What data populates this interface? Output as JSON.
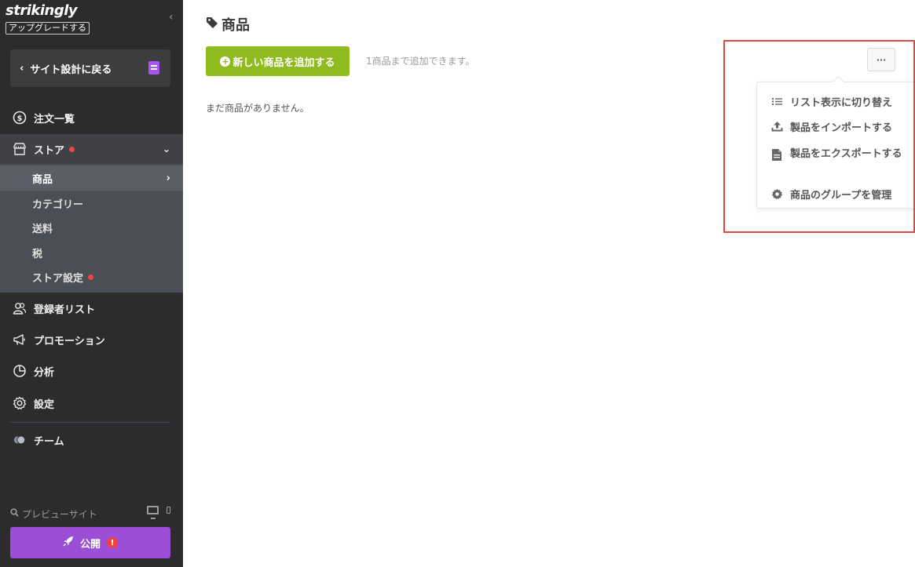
{
  "sidebar": {
    "logo": "strikingly",
    "upgrade_label": "アップグレードする",
    "back_label": "サイト設計に戻る",
    "nav": {
      "orders": "注文一覧",
      "store": "ストア",
      "subscribers": "登録者リスト",
      "promotion": "プロモーション",
      "analytics": "分析",
      "settings": "設定",
      "team": "チーム"
    },
    "store_items": {
      "products": "商品",
      "categories": "カテゴリー",
      "shipping": "送料",
      "tax": "税",
      "store_settings": "ストア設定"
    },
    "preview_label": "プレビューサイト",
    "publish_label": "公開",
    "publish_warning": "!"
  },
  "main": {
    "title": "商品",
    "add_button": "新しい商品を追加する",
    "limit_text": "1商品まで追加できます。",
    "empty_text": "まだ商品がありません。",
    "more_button": "···",
    "menu": {
      "list_view": "リスト表示に切り替え",
      "import": "製品をインポートする",
      "export": "製品をエクスポートする",
      "groups": "商品のグループを管理"
    }
  },
  "colors": {
    "sidebar_bg": "#2c2c2e",
    "add_button": "#8fbb1f",
    "publish_button": "#9b4fd6",
    "notification_dot": "#ef4444",
    "highlight_border": "#e04848"
  }
}
